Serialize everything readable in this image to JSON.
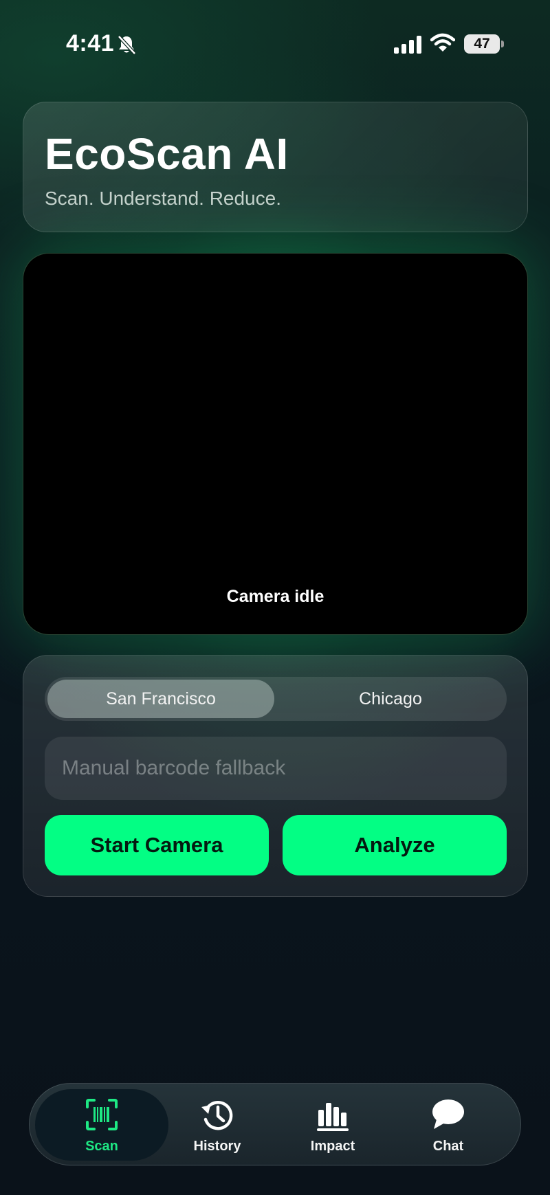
{
  "status_bar": {
    "time": "4:41",
    "battery": "47"
  },
  "header": {
    "title": "EcoScan AI",
    "tagline": "Scan. Understand. Reduce."
  },
  "camera": {
    "status": "Camera idle"
  },
  "location_selector": {
    "options": [
      "San Francisco",
      "Chicago"
    ],
    "selected": "San Francisco"
  },
  "barcode": {
    "placeholder": "Manual barcode fallback",
    "value": ""
  },
  "actions": {
    "start_camera": "Start Camera",
    "analyze": "Analyze"
  },
  "tabs": [
    {
      "label": "Scan",
      "icon": "barcode-scan-icon",
      "active": true
    },
    {
      "label": "History",
      "icon": "history-icon",
      "active": false
    },
    {
      "label": "Impact",
      "icon": "bar-chart-icon",
      "active": false
    },
    {
      "label": "Chat",
      "icon": "chat-bubble-icon",
      "active": false
    }
  ],
  "colors": {
    "accent": "#03fe84",
    "active_tab_label": "#1ee884"
  }
}
